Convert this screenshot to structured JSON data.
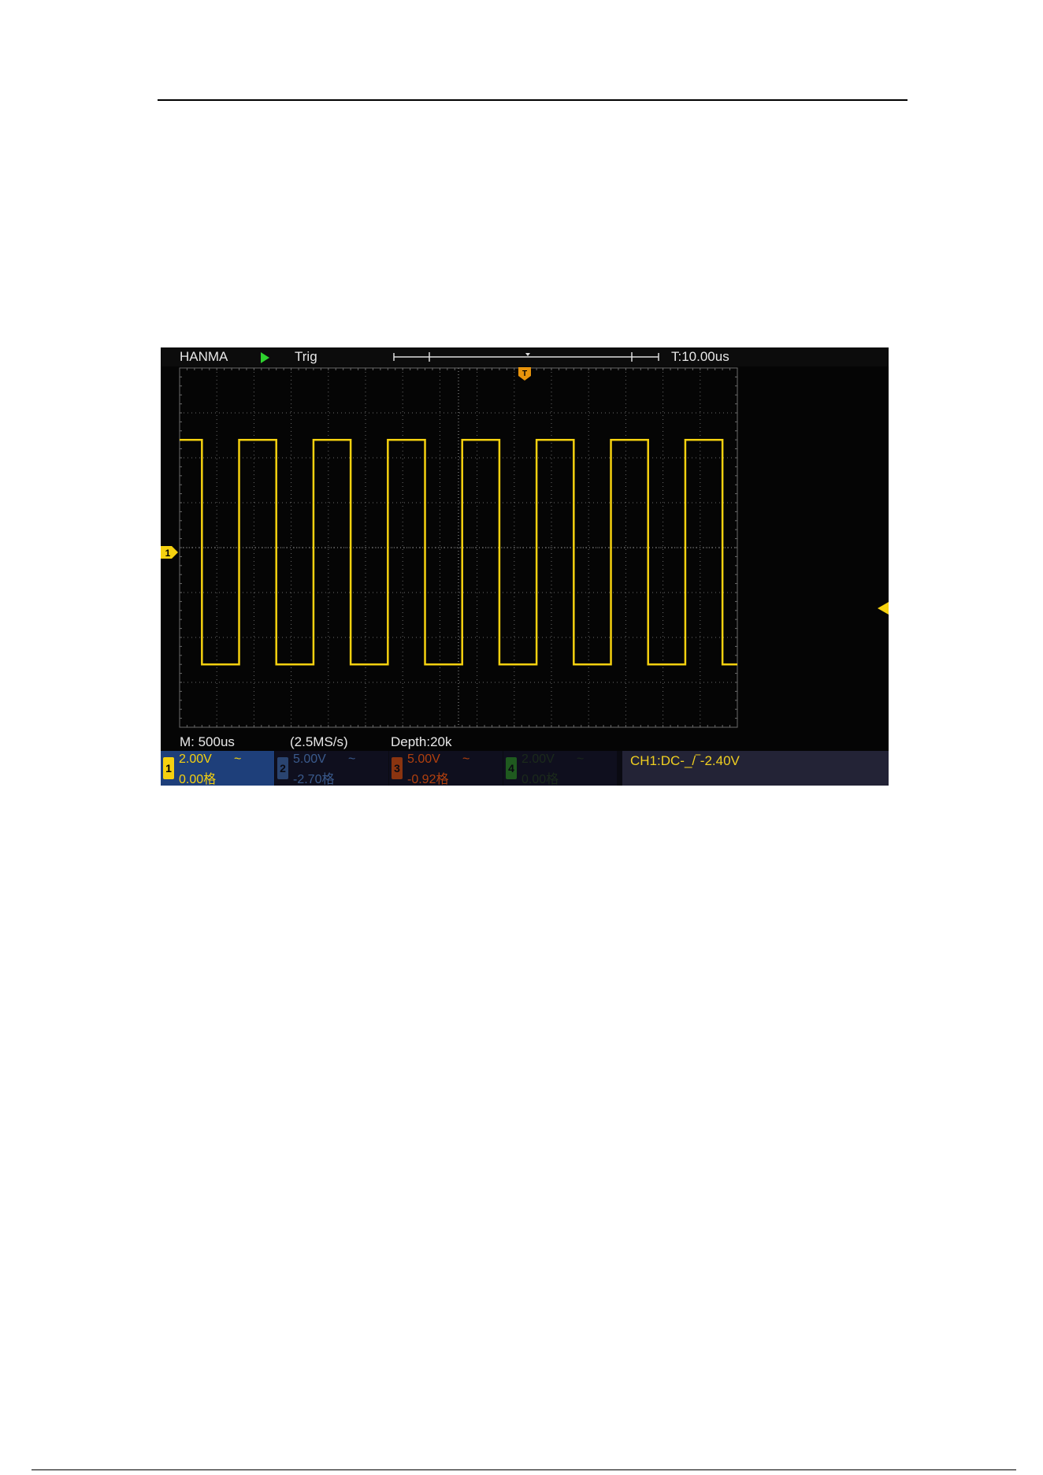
{
  "topbar": {
    "brand": "HANMA",
    "status": "Trig",
    "trigger_time": "T:10.00us"
  },
  "status": {
    "timebase": "M: 500us",
    "sample_rate": "(2.5MS/s)",
    "depth": "Depth:20k"
  },
  "channels": [
    {
      "num": "1",
      "volts": "2.00V",
      "coupling": "~",
      "offset": "0.00格",
      "active": true
    },
    {
      "num": "2",
      "volts": "5.00V",
      "coupling": "~",
      "offset": "-2.70格",
      "active": false
    },
    {
      "num": "3",
      "volts": "5.00V",
      "coupling": "~",
      "offset": "-0.92格",
      "active": false
    },
    {
      "num": "4",
      "volts": "2.00V",
      "coupling": "~",
      "offset": "0.00格",
      "active": false
    }
  ],
  "trigger_info": "CH1:DC-_/‾-2.40V",
  "markers": {
    "channel1": "1",
    "trigger": "T"
  },
  "colors": {
    "ch1": "#f5d10f",
    "ch2": "#3a5a8c",
    "ch3": "#c2410c",
    "ch4": "#1f6f1f",
    "ch1_panel": "#1e3f7a",
    "grid": "#6a6a6a",
    "run": "#2ed12e"
  },
  "waveform": {
    "type": "square",
    "high_div": 2.4,
    "low_div": -2.6,
    "period_div": 2.0,
    "high_duration_div": 1.0
  }
}
